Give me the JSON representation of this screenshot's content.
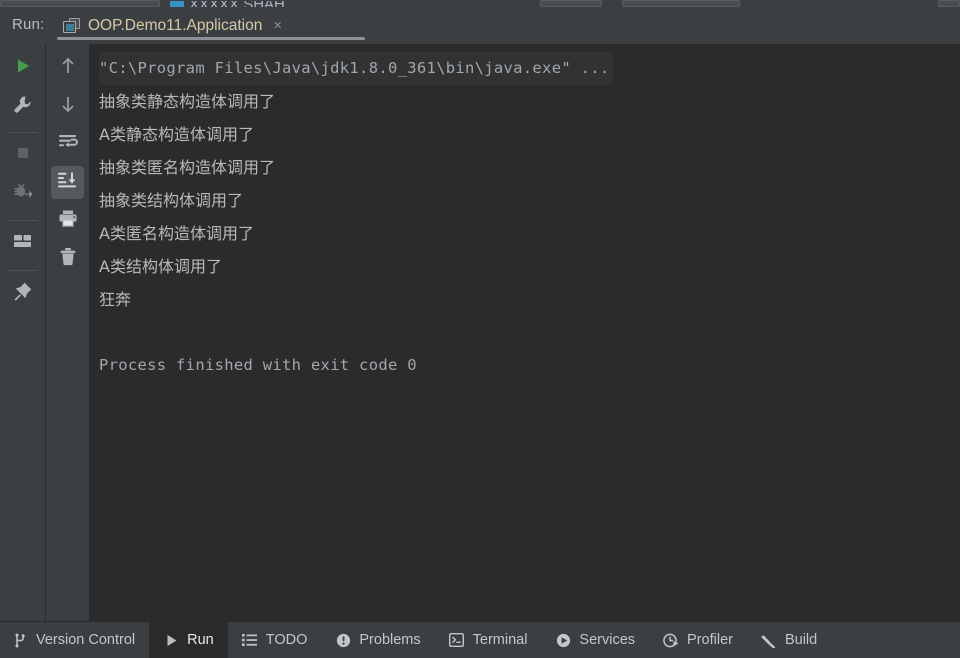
{
  "window": {
    "background": "#3c3f41",
    "console_background": "#2b2b2b",
    "accent": "#3592c4"
  },
  "top_strip": {
    "partial_tab_label": "XXXXX.SHAH",
    "icon": "module-icon"
  },
  "run_header": {
    "label": "Run:",
    "tab": {
      "icon": "run-configuration-icon",
      "title": "OOP.Demo11.Application",
      "close_label": "×",
      "active": true
    }
  },
  "left_toolbar": {
    "primary": [
      {
        "name": "rerun-button",
        "icon": "play-icon",
        "tooltip": "Rerun"
      },
      {
        "name": "settings-button",
        "icon": "wrench-icon",
        "tooltip": "Modify Run Configuration"
      },
      {
        "name": "stop-button",
        "icon": "stop-icon",
        "tooltip": "Stop"
      },
      {
        "name": "debug-button",
        "icon": "bug-icon",
        "tooltip": "Attach Debugger"
      },
      {
        "name": "layout-button",
        "icon": "layout-icon",
        "tooltip": "Layout Settings"
      },
      {
        "name": "pin-button",
        "icon": "pin-icon",
        "tooltip": "Pin Tab"
      }
    ],
    "secondary": [
      {
        "name": "up-button",
        "icon": "arrow-up-icon",
        "tooltip": "Up the Stack Trace"
      },
      {
        "name": "down-button",
        "icon": "arrow-down-icon",
        "tooltip": "Down the Stack Trace"
      },
      {
        "name": "soft-wrap-button",
        "icon": "soft-wrap-icon",
        "tooltip": "Soft-Wrap"
      },
      {
        "name": "scroll-to-end-button",
        "icon": "scroll-to-end-icon",
        "tooltip": "Scroll to End",
        "selected": true
      },
      {
        "name": "print-button",
        "icon": "printer-icon",
        "tooltip": "Print"
      },
      {
        "name": "clear-button",
        "icon": "trash-icon",
        "tooltip": "Clear All"
      }
    ]
  },
  "console": {
    "lines": [
      {
        "text": "\"C:\\Program Files\\Java\\jdk1.8.0_361\\bin\\java.exe\" ...",
        "style": "cmd"
      },
      {
        "text": "抽象类静态构造体调用了",
        "style": "cjk"
      },
      {
        "text": "A类静态构造体调用了",
        "style": "cjk"
      },
      {
        "text": "抽象类匿名构造体调用了",
        "style": "cjk"
      },
      {
        "text": "抽象类结构体调用了",
        "style": "cjk"
      },
      {
        "text": "A类匿名构造体调用了",
        "style": "cjk"
      },
      {
        "text": "A类结构体调用了",
        "style": "cjk"
      },
      {
        "text": "狂奔",
        "style": "cjk"
      },
      {
        "text": "",
        "style": "blank"
      },
      {
        "text": "Process finished with exit code 0",
        "style": "mono"
      }
    ]
  },
  "statusbar": {
    "items": [
      {
        "label": "Version Control",
        "icon": "branch-icon",
        "active": false
      },
      {
        "label": "Run",
        "icon": "play-icon",
        "active": true
      },
      {
        "label": "TODO",
        "icon": "list-icon",
        "active": false
      },
      {
        "label": "Problems",
        "icon": "exclamation-circle-icon",
        "active": false
      },
      {
        "label": "Terminal",
        "icon": "terminal-icon",
        "active": false
      },
      {
        "label": "Services",
        "icon": "services-icon",
        "active": false
      },
      {
        "label": "Profiler",
        "icon": "profiler-icon",
        "active": false
      },
      {
        "label": "Build",
        "icon": "hammer-icon",
        "active": false
      }
    ]
  }
}
